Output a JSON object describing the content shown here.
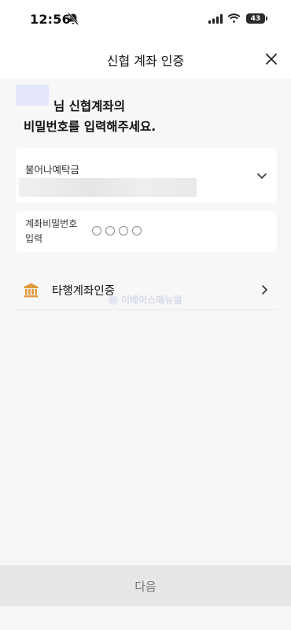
{
  "status_bar": {
    "time": "12:56",
    "battery": "43"
  },
  "header": {
    "title": "신협 계좌 인증"
  },
  "intro": {
    "line1_suffix": "님 신협계좌의",
    "line2": "비밀번호를 입력해주세요."
  },
  "bank_select": {
    "label": "불어나예탁금"
  },
  "password": {
    "label_line1": "계좌비밀번호",
    "label_line2": "입력",
    "digits": 4
  },
  "other_bank": {
    "label": "타행계좌인증"
  },
  "watermark": {
    "text": "이베이스매뉴얼"
  },
  "footer": {
    "next_label": "다음"
  },
  "colors": {
    "background": "#f7f7f7",
    "card": "#ffffff",
    "bank_icon": "#e09a3c",
    "button_bg": "#e6e6e6"
  }
}
